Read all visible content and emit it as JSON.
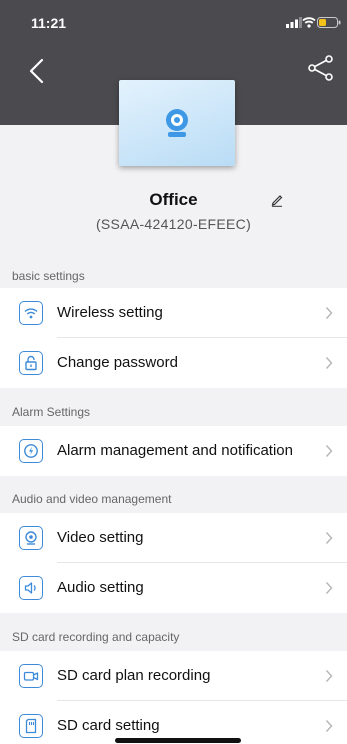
{
  "status_bar": {
    "time": "11:21"
  },
  "device": {
    "name": "Office",
    "id": "(SSAA-424120-EFEEC)"
  },
  "sections": [
    {
      "title": "basic settings",
      "items": [
        {
          "label": "Wireless setting",
          "icon": "wifi-icon"
        },
        {
          "label": "Change password",
          "icon": "lock-icon"
        }
      ]
    },
    {
      "title": "Alarm Settings",
      "items": [
        {
          "label": "Alarm management and notification",
          "icon": "alarm-icon"
        }
      ]
    },
    {
      "title": "Audio and video management",
      "items": [
        {
          "label": "Video setting",
          "icon": "webcam-icon"
        },
        {
          "label": "Audio setting",
          "icon": "speaker-icon"
        }
      ]
    },
    {
      "title": "SD card recording and capacity",
      "items": [
        {
          "label": "SD card plan recording",
          "icon": "video-record-icon"
        },
        {
          "label": "SD card setting",
          "icon": "sd-card-icon"
        }
      ]
    }
  ],
  "colors": {
    "header": "#4b4b4f",
    "accent": "#3d8bd8",
    "background": "#f2f2f4"
  }
}
